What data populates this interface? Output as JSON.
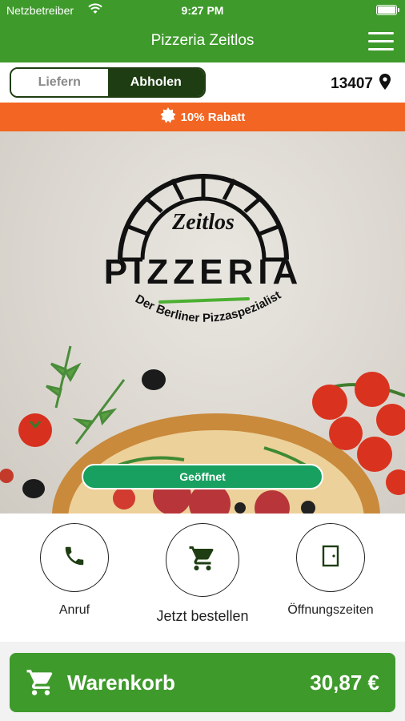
{
  "status": {
    "carrier": "Netzbetreiber",
    "time": "9:27 PM"
  },
  "navbar": {
    "title": "Pizzeria Zeitlos"
  },
  "mode": {
    "deliver": "Liefern",
    "pickup": "Abholen",
    "postal_code": "13407"
  },
  "promo": {
    "text": "10% Rabatt"
  },
  "logo": {
    "name": "Zeitlos",
    "brand": "PIZZERIA",
    "tagline": "Der Berliner Pizzaspezialist"
  },
  "hero": {
    "status": "Geöffnet"
  },
  "actions": {
    "call": "Anruf",
    "order": "Jetzt bestellen",
    "hours": "Öffnungszeiten"
  },
  "cart": {
    "label": "Warenkorb",
    "total": "30,87 €"
  },
  "colors": {
    "primary": "#3f9a2c",
    "dark": "#1f3d12",
    "promo": "#f26522",
    "open": "#17a05f"
  }
}
